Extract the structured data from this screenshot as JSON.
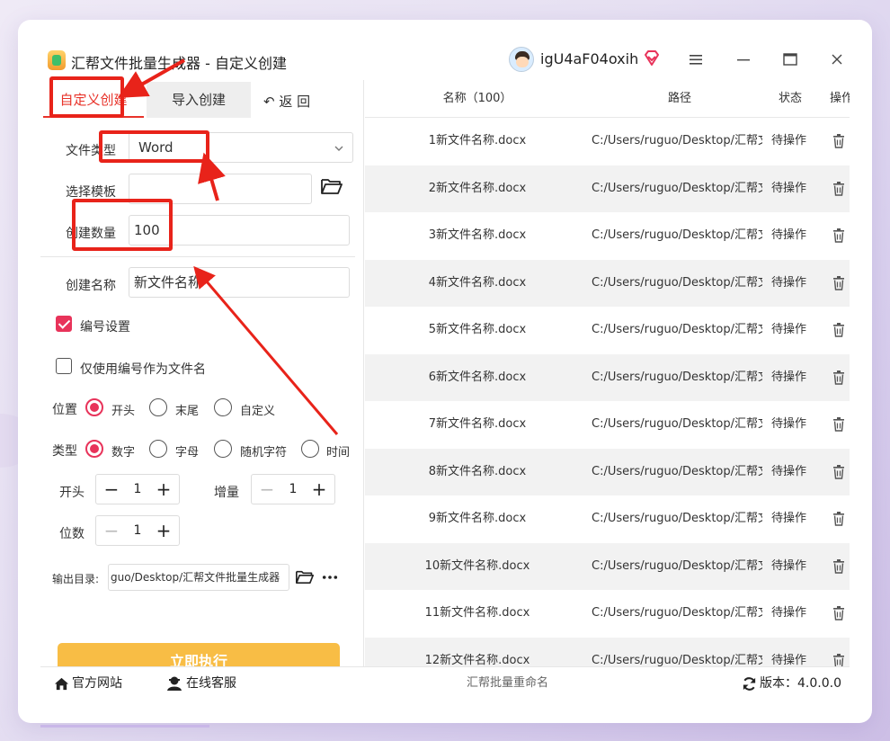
{
  "app": {
    "title": "汇帮文件批量生成器 - 自定义创建",
    "username": "igU4aF04oxih",
    "accent_color": "#e8335a",
    "annotation_color": "#e8231a"
  },
  "tabs": {
    "custom": "自定义创建",
    "import": "导入创建",
    "back": "↶ 返 回"
  },
  "form": {
    "file_type_label": "文件类型",
    "file_type_value": "Word",
    "template_label": "选择模板",
    "template_value": "",
    "count_label": "创建数量",
    "count_value": "100",
    "name_label": "创建名称",
    "name_value": "新文件名称",
    "numbering_label": "编号设置",
    "numbering_checked": true,
    "only_number_label": "仅使用编号作为文件名",
    "only_number_checked": false,
    "position_label": "位置",
    "position_options": [
      "开头",
      "末尾",
      "自定义"
    ],
    "position_selected": "开头",
    "type_label": "类型",
    "type_options": [
      "数字",
      "字母",
      "随机字符",
      "时间"
    ],
    "type_selected": "数字",
    "start_label": "开头",
    "start_value": "1",
    "increment_label": "增量",
    "increment_value": "1",
    "digits_label": "位数",
    "digits_value": "1",
    "output_label": "输出目录:",
    "output_value": "guo/Desktop/汇帮文件批量生成器",
    "run_label": "立即执行"
  },
  "table": {
    "headers": [
      "名称（100）",
      "路径",
      "状态",
      "操作"
    ],
    "rows": [
      {
        "name": "1新文件名称.docx",
        "path": "C:/Users/ruguo/Desktop/汇帮文",
        "status": "待操作"
      },
      {
        "name": "2新文件名称.docx",
        "path": "C:/Users/ruguo/Desktop/汇帮文",
        "status": "待操作"
      },
      {
        "name": "3新文件名称.docx",
        "path": "C:/Users/ruguo/Desktop/汇帮文",
        "status": "待操作"
      },
      {
        "name": "4新文件名称.docx",
        "path": "C:/Users/ruguo/Desktop/汇帮文",
        "status": "待操作"
      },
      {
        "name": "5新文件名称.docx",
        "path": "C:/Users/ruguo/Desktop/汇帮文",
        "status": "待操作"
      },
      {
        "name": "6新文件名称.docx",
        "path": "C:/Users/ruguo/Desktop/汇帮文",
        "status": "待操作"
      },
      {
        "name": "7新文件名称.docx",
        "path": "C:/Users/ruguo/Desktop/汇帮文",
        "status": "待操作"
      },
      {
        "name": "8新文件名称.docx",
        "path": "C:/Users/ruguo/Desktop/汇帮文",
        "status": "待操作"
      },
      {
        "name": "9新文件名称.docx",
        "path": "C:/Users/ruguo/Desktop/汇帮文",
        "status": "待操作"
      },
      {
        "name": "10新文件名称.docx",
        "path": "C:/Users/ruguo/Desktop/汇帮文",
        "status": "待操作"
      },
      {
        "name": "11新文件名称.docx",
        "path": "C:/Users/ruguo/Desktop/汇帮文",
        "status": "待操作"
      },
      {
        "name": "12新文件名称.docx",
        "path": "C:/Users/ruguo/Desktop/汇帮文",
        "status": "待操作"
      }
    ]
  },
  "footer": {
    "website": "官方网站",
    "support": "在线客服",
    "center_text": "汇帮批量重命名",
    "version": "版本：4.0.0.0"
  },
  "icons": [
    "app-logo-icon",
    "avatar-icon",
    "vip-diamond-icon",
    "menu-icon",
    "minimize-icon",
    "maximize-icon",
    "close-icon",
    "chevron-down-icon",
    "folder-icon",
    "more-icon",
    "trash-icon",
    "home-icon",
    "support-icon",
    "refresh-icon"
  ]
}
